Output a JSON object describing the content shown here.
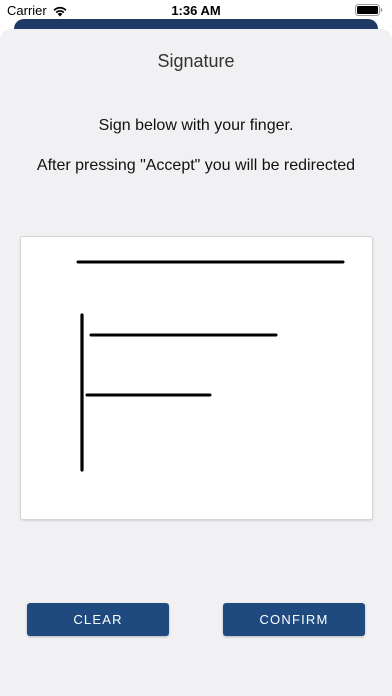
{
  "status_bar": {
    "carrier": "Carrier",
    "time": "1:36 AM",
    "wifi_icon": "wifi-icon",
    "battery_icon": "battery-icon"
  },
  "sheet": {
    "title": "Signature",
    "instruction_1": "Sign below with your finger.",
    "instruction_2": "After pressing \"Accept\" you will be redirected"
  },
  "buttons": {
    "clear_label": "CLEAR",
    "confirm_label": "CONFIRM"
  },
  "colors": {
    "accent": "#1e4a80",
    "sheet_background": "#f1f1f3",
    "presenter_background": "#1e3a64"
  }
}
